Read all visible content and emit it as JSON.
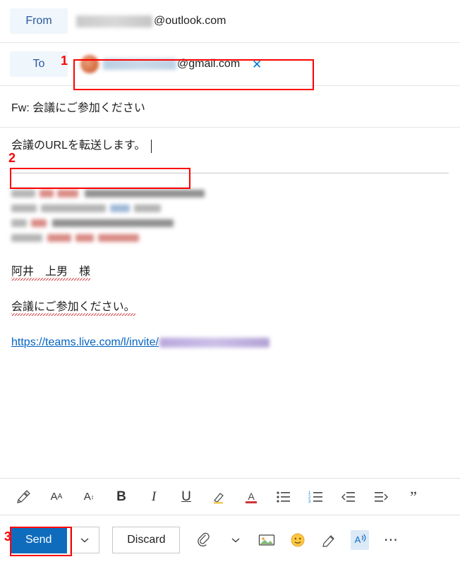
{
  "compose": {
    "from": {
      "label": "From",
      "redacted_name": "",
      "domain": "@outlook.com"
    },
    "to": {
      "label": "To",
      "redacted_name": "",
      "domain": "@gmail.com",
      "remove_icon": "✕"
    },
    "subject": "Fw: 会議にご参加ください",
    "body": {
      "typed_text": "会議のURLを転送します。",
      "quoted_greeting": "阿井　上男　様",
      "quoted_sentence": "会議にご参加ください。",
      "link_text": "https://teams.live.com/l/invite/"
    },
    "annotations": [
      {
        "number": "1",
        "target": "to-recipient-pill"
      },
      {
        "number": "2",
        "target": "typed-body-text"
      },
      {
        "number": "3",
        "target": "send-button"
      }
    ],
    "format_toolbar": [
      {
        "name": "format-painter-icon",
        "glyph": "🖌"
      },
      {
        "name": "font-size-grow-icon",
        "glyph": "Aᴀ"
      },
      {
        "name": "font-size-shrink-icon",
        "glyph": "Aˇ"
      },
      {
        "name": "bold-icon",
        "glyph": "B"
      },
      {
        "name": "italic-icon",
        "glyph": "I"
      },
      {
        "name": "underline-icon",
        "glyph": "U"
      },
      {
        "name": "highlight-icon",
        "glyph": "✎"
      },
      {
        "name": "font-color-icon",
        "glyph": "A"
      },
      {
        "name": "bulleted-list-icon",
        "glyph": "☰"
      },
      {
        "name": "numbered-list-icon",
        "glyph": "≡"
      },
      {
        "name": "decrease-indent-icon",
        "glyph": "←"
      },
      {
        "name": "increase-indent-icon",
        "glyph": "→"
      },
      {
        "name": "quote-icon",
        "glyph": "”"
      }
    ],
    "actions": {
      "send_label": "Send",
      "send_more_icon": "⌄",
      "discard_label": "Discard",
      "icons": [
        {
          "name": "attach-icon",
          "glyph": "📎"
        },
        {
          "name": "attach-chevron-icon",
          "glyph": "⌄"
        },
        {
          "name": "insert-picture-icon",
          "glyph": "🖼"
        },
        {
          "name": "emoji-icon",
          "glyph": "🙂"
        },
        {
          "name": "signature-icon",
          "glyph": "✎"
        },
        {
          "name": "dictate-icon",
          "glyph": "A"
        },
        {
          "name": "more-options-icon",
          "glyph": "⋯"
        }
      ]
    }
  }
}
